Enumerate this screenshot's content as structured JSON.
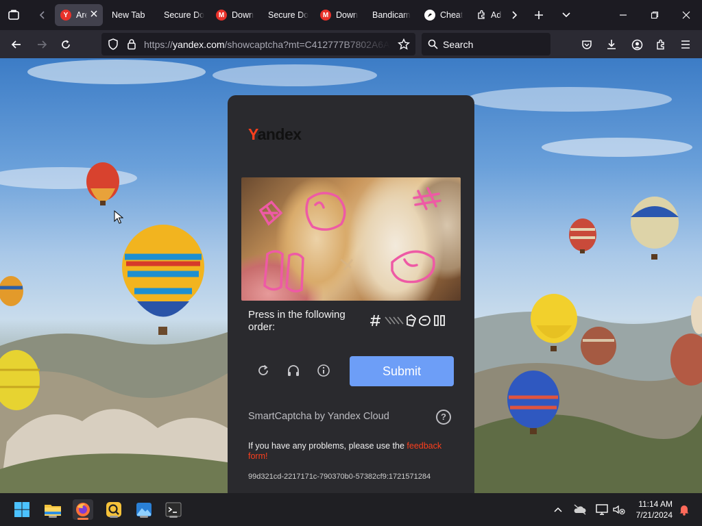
{
  "browser": {
    "tabs": [
      {
        "label": "Are",
        "active": true,
        "favicon": "yandex-icon"
      },
      {
        "label": "New Tab",
        "active": false
      },
      {
        "label": "Secure Do",
        "active": false
      },
      {
        "label": "Down",
        "active": false,
        "favicon": "mega-icon"
      },
      {
        "label": "Secure Do",
        "active": false
      },
      {
        "label": "Down",
        "active": false,
        "favicon": "mega-icon"
      },
      {
        "label": "Bandicam",
        "active": false
      },
      {
        "label": "Cheat",
        "active": false,
        "favicon": "cheat-icon"
      },
      {
        "label": "Ad",
        "active": false,
        "favicon": "extension-icon"
      }
    ],
    "url": {
      "prefix": "https://",
      "domain": "yandex.com",
      "path": "/showcaptcha?mt=C412777B7802A6A"
    },
    "search_placeholder": "Search"
  },
  "captcha": {
    "brand_y": "Y",
    "brand_rest": "andex",
    "instruction": "Press in the following order:",
    "submit_label": "Submit",
    "footer_brand": "SmartCaptcha by Yandex Cloud",
    "help_glyph": "?",
    "problems_text": "If you have any problems, please use the ",
    "problems_link": "feedback form",
    "problems_end": "!",
    "request_id": "99d321cd-2217171c-790370b0-57382cf9:1721571284"
  },
  "taskbar": {
    "time": "11:14 AM",
    "date": "7/21/2024"
  },
  "colors": {
    "accent": "#6d9ef7",
    "yandex_red": "#fc3f1d",
    "card_bg": "#2a2a2e"
  }
}
